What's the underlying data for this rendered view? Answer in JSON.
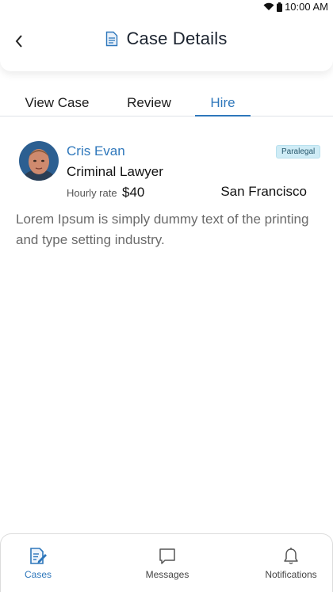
{
  "status_bar": {
    "time": "10:00 AM"
  },
  "header": {
    "title": "Case Details",
    "back_icon": "chevron-left-icon",
    "title_icon": "document-icon"
  },
  "tabs": [
    {
      "label": "View Case",
      "active": false
    },
    {
      "label": "Review",
      "active": false
    },
    {
      "label": "Hire",
      "active": true
    }
  ],
  "profile": {
    "name": "Cris Evan",
    "role": "Criminal Lawyer",
    "badge": "Paralegal",
    "rate_label": "Hourly rate",
    "rate_value": "$40",
    "location": "San Francisco",
    "description": "Lorem Ipsum is simply dummy text of the printing and type setting industry."
  },
  "bottom_nav": [
    {
      "label": "Cases",
      "icon": "cases-icon",
      "active": true
    },
    {
      "label": "Messages",
      "icon": "message-icon",
      "active": false
    },
    {
      "label": "Notifications",
      "icon": "bell-icon",
      "active": false
    }
  ],
  "colors": {
    "accent": "#2e77bb",
    "badge_bg": "#cfecf6"
  }
}
